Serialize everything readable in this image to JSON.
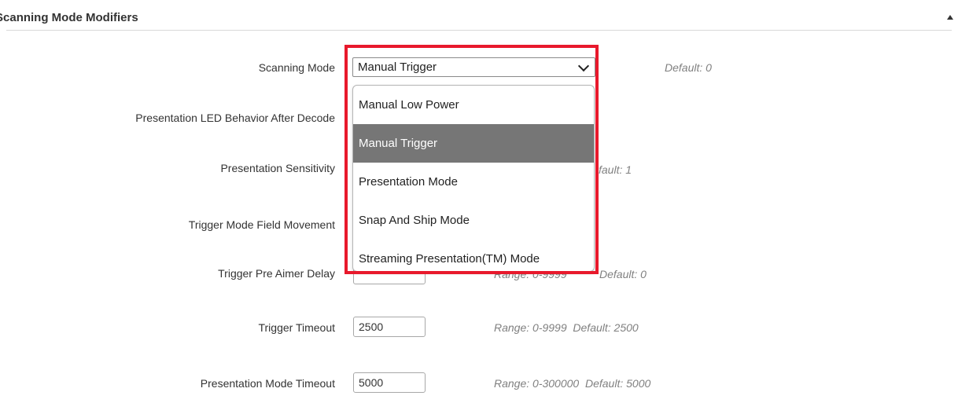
{
  "section": {
    "title": "Scanning Mode Modifiers"
  },
  "highlight_color": "#e8192c",
  "rows": {
    "scanning_mode": {
      "label": "Scanning Mode",
      "value": "Manual Trigger",
      "hint": "Default: 0"
    },
    "led_behavior": {
      "label": "Presentation LED Behavior After Decode"
    },
    "sensitivity": {
      "label": "Presentation Sensitivity",
      "hint": "fault: 1"
    },
    "field_movement": {
      "label": "Trigger Mode Field Movement"
    },
    "pre_aimer": {
      "label": "Trigger Pre Aimer Delay",
      "hint_range": "Range: 0-9999",
      "hint": "Default: 0"
    },
    "trigger_timeout": {
      "label": "Trigger Timeout",
      "value": "2500",
      "hint": "Range: 0-9999  Default: 2500"
    },
    "presentation_timeout": {
      "label": "Presentation Mode Timeout",
      "value": "5000",
      "hint": "Range: 0-300000  Default: 5000"
    }
  },
  "dropdown": {
    "options": [
      "Manual Low Power",
      "Manual Trigger",
      "Presentation Mode",
      "Snap And Ship Mode",
      "Streaming Presentation(TM) Mode"
    ],
    "selected": "Manual Trigger"
  }
}
